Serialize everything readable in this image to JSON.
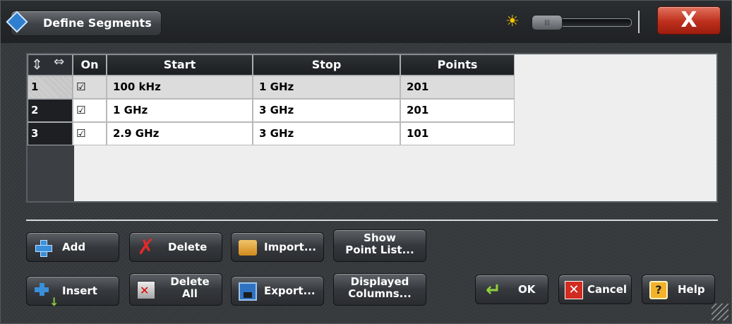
{
  "window": {
    "title": "Define Segments",
    "close_label": "X",
    "icons": {
      "logo": "rs-logo-icon",
      "brightness": "brightness-sun-icon"
    }
  },
  "table": {
    "columns": [
      "On",
      "Start",
      "Stop",
      "Points"
    ],
    "rows": [
      {
        "num": "1",
        "on": "☑",
        "start": "100 kHz",
        "stop": "1 GHz",
        "points": "201"
      },
      {
        "num": "2",
        "on": "☑",
        "start": "1 GHz",
        "stop": "3 GHz",
        "points": "201"
      },
      {
        "num": "3",
        "on": "☑",
        "start": "2.9 GHz",
        "stop": "3 GHz",
        "points": "101"
      }
    ]
  },
  "buttons": {
    "add": "Add",
    "delete": "Delete",
    "import": "Import...",
    "show_point_list_1": "Show",
    "show_point_list_2": "Point List...",
    "insert": "Insert",
    "delete_all_1": "Delete",
    "delete_all_2": "All",
    "export": "Export...",
    "displayed_columns_1": "Displayed",
    "displayed_columns_2": "Columns...",
    "ok": "OK",
    "cancel": "Cancel",
    "help": "Help"
  },
  "colors": {
    "accent_close": "#bd2f1c",
    "plus_blue": "#3a8fd9",
    "sun": "#f5c400"
  }
}
